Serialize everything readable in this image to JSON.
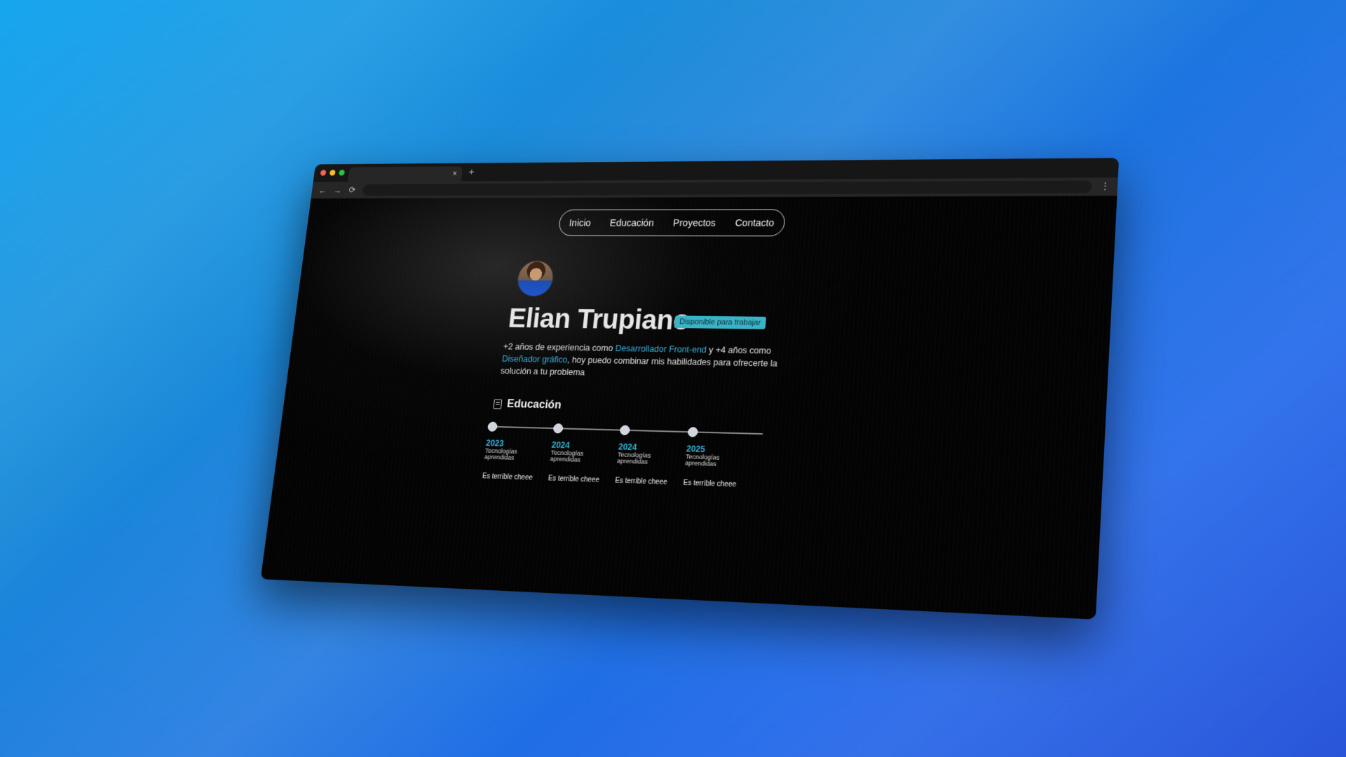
{
  "browser": {
    "tab": {
      "close": "×"
    },
    "new_tab": "+",
    "back": "←",
    "forward": "→",
    "reload": "⟳",
    "menu": "⋮"
  },
  "nav": [
    "Inicio",
    "Educación",
    "Proyectos",
    "Contacto"
  ],
  "hero": {
    "name": "Elian Trupiano",
    "badge": "Disponible para trabajar",
    "bio_1": "+2 años de experiencia como ",
    "bio_link_1": "Desarrollador Front-end",
    "bio_2": " y +4 años como ",
    "bio_link_2": "Diseñador gráfico",
    "bio_3": ", hoy puedo combinar mis habilidades para ofrecerte la solución a tu problema"
  },
  "education": {
    "title": "Educación",
    "items": [
      {
        "year": "2023",
        "label": "Tecnologías aprendidas",
        "note": "Es terrible cheee"
      },
      {
        "year": "2024",
        "label": "Tecnologías aprendidas",
        "note": "Es terrible cheee"
      },
      {
        "year": "2024",
        "label": "Tecnologías aprendidas",
        "note": "Es terrible cheee"
      },
      {
        "year": "2025",
        "label": "Tecnologías aprendidas",
        "note": "Es terrible cheee"
      }
    ]
  },
  "colors": {
    "accent": "#36b5e3",
    "badge": "#3bb3c6",
    "background": "#030303"
  }
}
